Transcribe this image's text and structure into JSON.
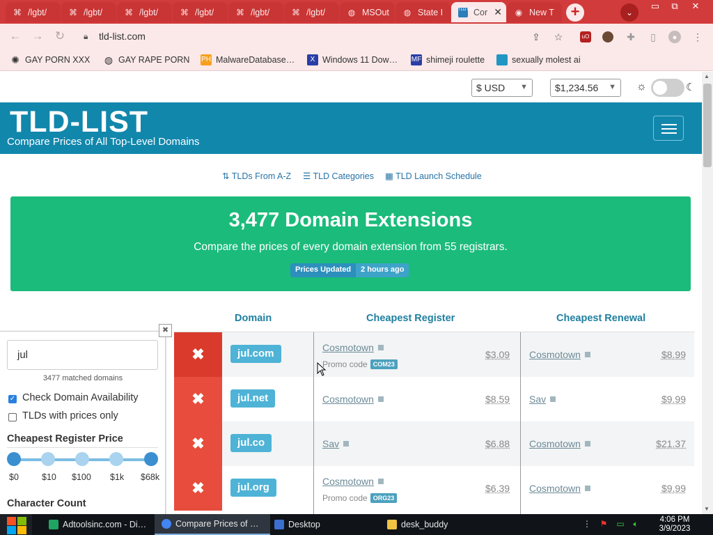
{
  "browser": {
    "tabs": [
      {
        "title": "/lgbt/",
        "icon": "clover-icon"
      },
      {
        "title": "/lgbt/",
        "icon": "clover-icon"
      },
      {
        "title": "/lgbt/",
        "icon": "clover-icon"
      },
      {
        "title": "/lgbt/",
        "icon": "clover-icon"
      },
      {
        "title": "/lgbt/",
        "icon": "clover-icon"
      },
      {
        "title": "/lgbt/",
        "icon": "clover-icon"
      },
      {
        "title": "MSOut",
        "icon": "globe-icon"
      },
      {
        "title": "State I",
        "icon": "globe-icon"
      },
      {
        "title": "Cor",
        "icon": "tld-list-icon",
        "active": true
      },
      {
        "title": "New T",
        "icon": "chrome-icon"
      }
    ],
    "new_tab_symbol": "+",
    "tab_search_symbol": "⌄",
    "window_controls": {
      "minimize": "▭",
      "restore": "⧉",
      "close": "✕"
    },
    "url": "tld-list.com",
    "bookmarks": [
      {
        "label": "GAY PORN XXX",
        "icon": "spider-icon"
      },
      {
        "label": "GAY RAPE PORN",
        "icon": "globe-icon"
      },
      {
        "label": "MalwareDatabase…",
        "icon": "ph-icon",
        "icon_text": "PH"
      },
      {
        "label": "Windows 11 Dow…",
        "icon": "x-icon",
        "icon_text": "X"
      },
      {
        "label": "shimeji roulette",
        "icon": "mft-icon",
        "icon_text": "MF"
      },
      {
        "label": "sexually molest ai",
        "icon": "bookmark-app-icon"
      }
    ]
  },
  "site": {
    "currency": "$ USD",
    "price_limit": "$1,234.56",
    "logo": "TLD-LIST",
    "tagline": "Compare Prices of All Top-Level Domains",
    "nav": [
      {
        "label": "TLDs From A-Z",
        "icon": "sort-alpha-icon"
      },
      {
        "label": "TLD Categories",
        "icon": "list-icon"
      },
      {
        "label": "TLD Launch Schedule",
        "icon": "calendar-icon"
      }
    ],
    "hero": {
      "title": "3,477 Domain Extensions",
      "subtitle": "Compare the prices of every domain extension from 55 registrars.",
      "pill_label": "Prices Updated",
      "pill_value": "2 hours ago"
    },
    "table": {
      "headers": [
        "Domain",
        "Cheapest Register",
        "Cheapest Renewal"
      ],
      "rows": [
        {
          "domain": "jul.com",
          "register": "Cosmotown",
          "register_price": "$3.09",
          "promo_label": "Promo code",
          "promo_code": "COM23",
          "renewal": "Cosmotown",
          "renewal_price": "$8.99"
        },
        {
          "domain": "jul.net",
          "register": "Cosmotown",
          "register_price": "$8.59",
          "renewal": "Sav",
          "renewal_price": "$9.99"
        },
        {
          "domain": "jul.co",
          "register": "Sav",
          "register_price": "$6.88",
          "renewal": "Cosmotown",
          "renewal_price": "$21.37"
        },
        {
          "domain": "jul.org",
          "register": "Cosmotown",
          "register_price": "$6.39",
          "promo_label": "Promo code",
          "promo_code": "ORG23",
          "renewal": "Cosmotown",
          "renewal_price": "$9.99"
        }
      ],
      "remove_symbol": "✖"
    },
    "sidebar": {
      "search_value": "jul",
      "matched": "3477 matched domains",
      "check_availability": "Check Domain Availability",
      "check_availability_checked": true,
      "prices_only": "TLDs with prices only",
      "prices_only_checked": false,
      "price_heading": "Cheapest Register Price",
      "price_ticks": [
        "$0",
        "$10",
        "$100",
        "$1k",
        "$68k"
      ],
      "char_heading": "Character Count",
      "close_symbol": "✖"
    }
  },
  "taskbar": {
    "items": [
      {
        "label": "Adtoolsinc.com - Di…",
        "icon": "sheets-icon",
        "color": "#1fa463"
      },
      {
        "label": "Compare Prices of …",
        "icon": "chrome-icon",
        "color": "#4285f4",
        "active": true
      },
      {
        "label": "Desktop",
        "icon": "desktop-icon",
        "color": "#3b6fd0"
      },
      {
        "label": "desk_buddy",
        "icon": "folder-icon",
        "color": "#f0c343"
      }
    ],
    "time": "4:06 PM",
    "date": "3/9/2023"
  },
  "colors": {
    "tabstrip": "#d23b3b",
    "banner": "#1287ac",
    "hero": "#1bbb7b",
    "remove": "#e74c3c",
    "domain_badge": "#4eb3d6"
  }
}
